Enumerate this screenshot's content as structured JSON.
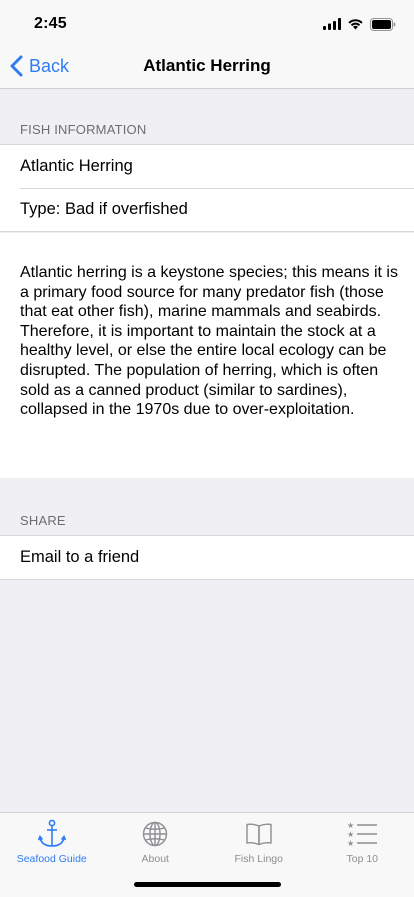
{
  "status_bar": {
    "time": "2:45"
  },
  "nav": {
    "back_label": "Back",
    "title": "Atlantic Herring"
  },
  "fish_info": {
    "header": "FISH INFORMATION",
    "name": "Atlantic Herring",
    "type": "Type: Bad if overfished",
    "description": "Atlantic herring is a keystone species; this means it is a primary food source for many predator fish (those that eat other fish), marine mammals and seabirds. Therefore, it is important to maintain the stock at a healthy level, or else the entire local ecology can be disrupted. The population of herring, which is often sold as a canned product (similar to sardines), collapsed in the 1970s due to over-exploitation."
  },
  "share": {
    "header": "SHARE",
    "email_label": "Email to a friend"
  },
  "tab_bar": {
    "tabs": [
      {
        "label": "Seafood Guide",
        "icon": "anchor-icon",
        "active": true
      },
      {
        "label": "About",
        "icon": "globe-icon",
        "active": false
      },
      {
        "label": "Fish Lingo",
        "icon": "book-icon",
        "active": false
      },
      {
        "label": "Top 10",
        "icon": "list-icon",
        "active": false
      }
    ]
  },
  "colors": {
    "accent": "#2f7cf6",
    "inactive": "#8e8e93",
    "background": "#efeff4"
  }
}
